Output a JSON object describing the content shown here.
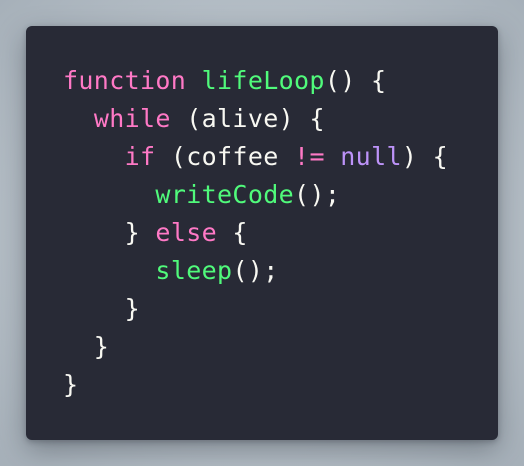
{
  "colors": {
    "background": "#b9c2ca",
    "card": "#282a36",
    "text": "#f8f8f2",
    "keyword": "#ff79c6",
    "function": "#50fa7b",
    "literal": "#bd93f9"
  },
  "code": {
    "lines": [
      [
        {
          "t": "function",
          "c": "kw"
        },
        {
          "t": " ",
          "c": "txt"
        },
        {
          "t": "lifeLoop",
          "c": "fn"
        },
        {
          "t": "() {",
          "c": "txt"
        }
      ],
      [
        {
          "t": "  ",
          "c": "txt"
        },
        {
          "t": "while",
          "c": "kw"
        },
        {
          "t": " (alive) {",
          "c": "txt"
        }
      ],
      [
        {
          "t": "    ",
          "c": "txt"
        },
        {
          "t": "if",
          "c": "kw"
        },
        {
          "t": " (coffee ",
          "c": "txt"
        },
        {
          "t": "!=",
          "c": "kw"
        },
        {
          "t": " ",
          "c": "txt"
        },
        {
          "t": "null",
          "c": "lit"
        },
        {
          "t": ") {",
          "c": "txt"
        }
      ],
      [
        {
          "t": "      ",
          "c": "txt"
        },
        {
          "t": "writeCode",
          "c": "fn"
        },
        {
          "t": "();",
          "c": "txt"
        }
      ],
      [
        {
          "t": "    } ",
          "c": "txt"
        },
        {
          "t": "else",
          "c": "kw"
        },
        {
          "t": " {",
          "c": "txt"
        }
      ],
      [
        {
          "t": "      ",
          "c": "txt"
        },
        {
          "t": "sleep",
          "c": "fn"
        },
        {
          "t": "();",
          "c": "txt"
        }
      ],
      [
        {
          "t": "    }",
          "c": "txt"
        }
      ],
      [
        {
          "t": "  }",
          "c": "txt"
        }
      ],
      [
        {
          "t": "}",
          "c": "txt"
        }
      ]
    ]
  }
}
